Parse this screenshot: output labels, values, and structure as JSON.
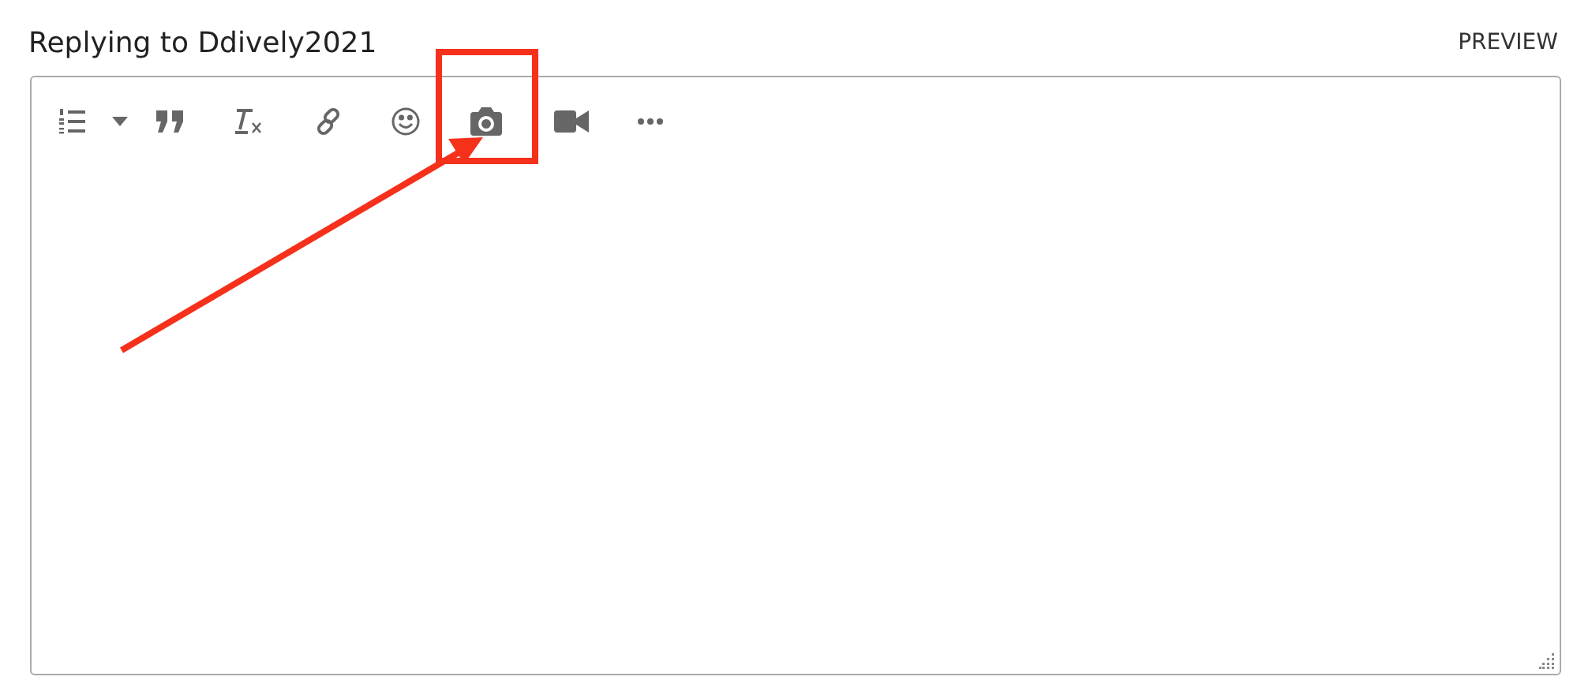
{
  "heading": "Replying to Ddively2021",
  "preview_link": "PREVIEW",
  "toolbar": [
    {
      "kind": "numbered-list",
      "highlighted": false
    },
    {
      "kind": "caret",
      "highlighted": false
    },
    {
      "kind": "quote",
      "highlighted": false
    },
    {
      "kind": "clear-format",
      "highlighted": false
    },
    {
      "kind": "link",
      "highlighted": false
    },
    {
      "kind": "emoji",
      "highlighted": false
    },
    {
      "kind": "camera",
      "highlighted": true
    },
    {
      "kind": "video",
      "highlighted": false
    },
    {
      "kind": "more",
      "highlighted": false
    }
  ]
}
